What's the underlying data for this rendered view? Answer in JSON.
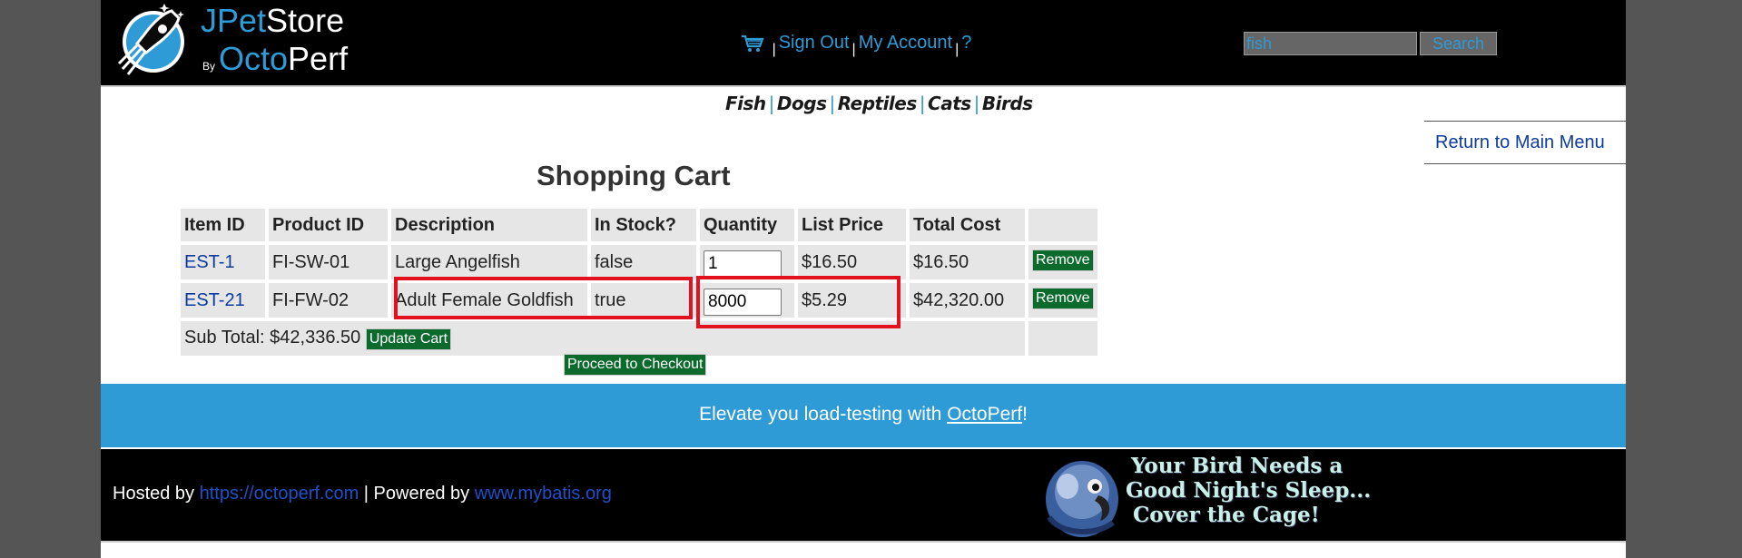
{
  "header": {
    "logo": {
      "jp": "JPet",
      "store": "Store",
      "by": "By",
      "octo": "Octo",
      "perf": "Perf"
    },
    "menu": {
      "sign_out": "Sign Out",
      "my_account": "My Account",
      "help": "?",
      "sep": "|"
    },
    "search": {
      "value": "fish",
      "button": "Search"
    }
  },
  "quicklinks": [
    "Fish",
    "Dogs",
    "Reptiles",
    "Cats",
    "Birds"
  ],
  "return_link": "Return to Main Menu",
  "cart": {
    "title": "Shopping Cart",
    "headers": [
      "Item ID",
      "Product ID",
      "Description",
      "In Stock?",
      "Quantity",
      "List Price",
      "Total Cost"
    ],
    "rows": [
      {
        "item_id": "EST-1",
        "product_id": "FI-SW-01",
        "description": "Large Angelfish",
        "in_stock": "false",
        "quantity": "1",
        "list_price": "$16.50",
        "total": "$16.50",
        "remove": "Remove"
      },
      {
        "item_id": "EST-21",
        "product_id": "FI-FW-02",
        "description": "Adult Female Goldfish",
        "in_stock": "true",
        "quantity": "8000",
        "list_price": "$5.29",
        "total": "$42,320.00",
        "remove": "Remove"
      }
    ],
    "subtotal": "Sub Total: $42,336.50",
    "update_button": "Update Cart",
    "checkout_button": "Proceed to Checkout"
  },
  "promo": {
    "prefix": "Elevate you load-testing with ",
    "link": "OctoPerf",
    "suffix": "!"
  },
  "footer": {
    "hosted_by": "Hosted by ",
    "hosted_link": "https://octoperf.com",
    "powered_by": " | Powered by ",
    "powered_link": "www.mybatis.org",
    "banner": {
      "line1": "Your Bird Needs a",
      "line2": "Good Night's Sleep...",
      "line3": "Cover the Cage!"
    }
  },
  "colors": {
    "accent_blue": "#2e9bd6",
    "button_green": "#0b6a2c",
    "highlight_red": "#e3101e"
  }
}
